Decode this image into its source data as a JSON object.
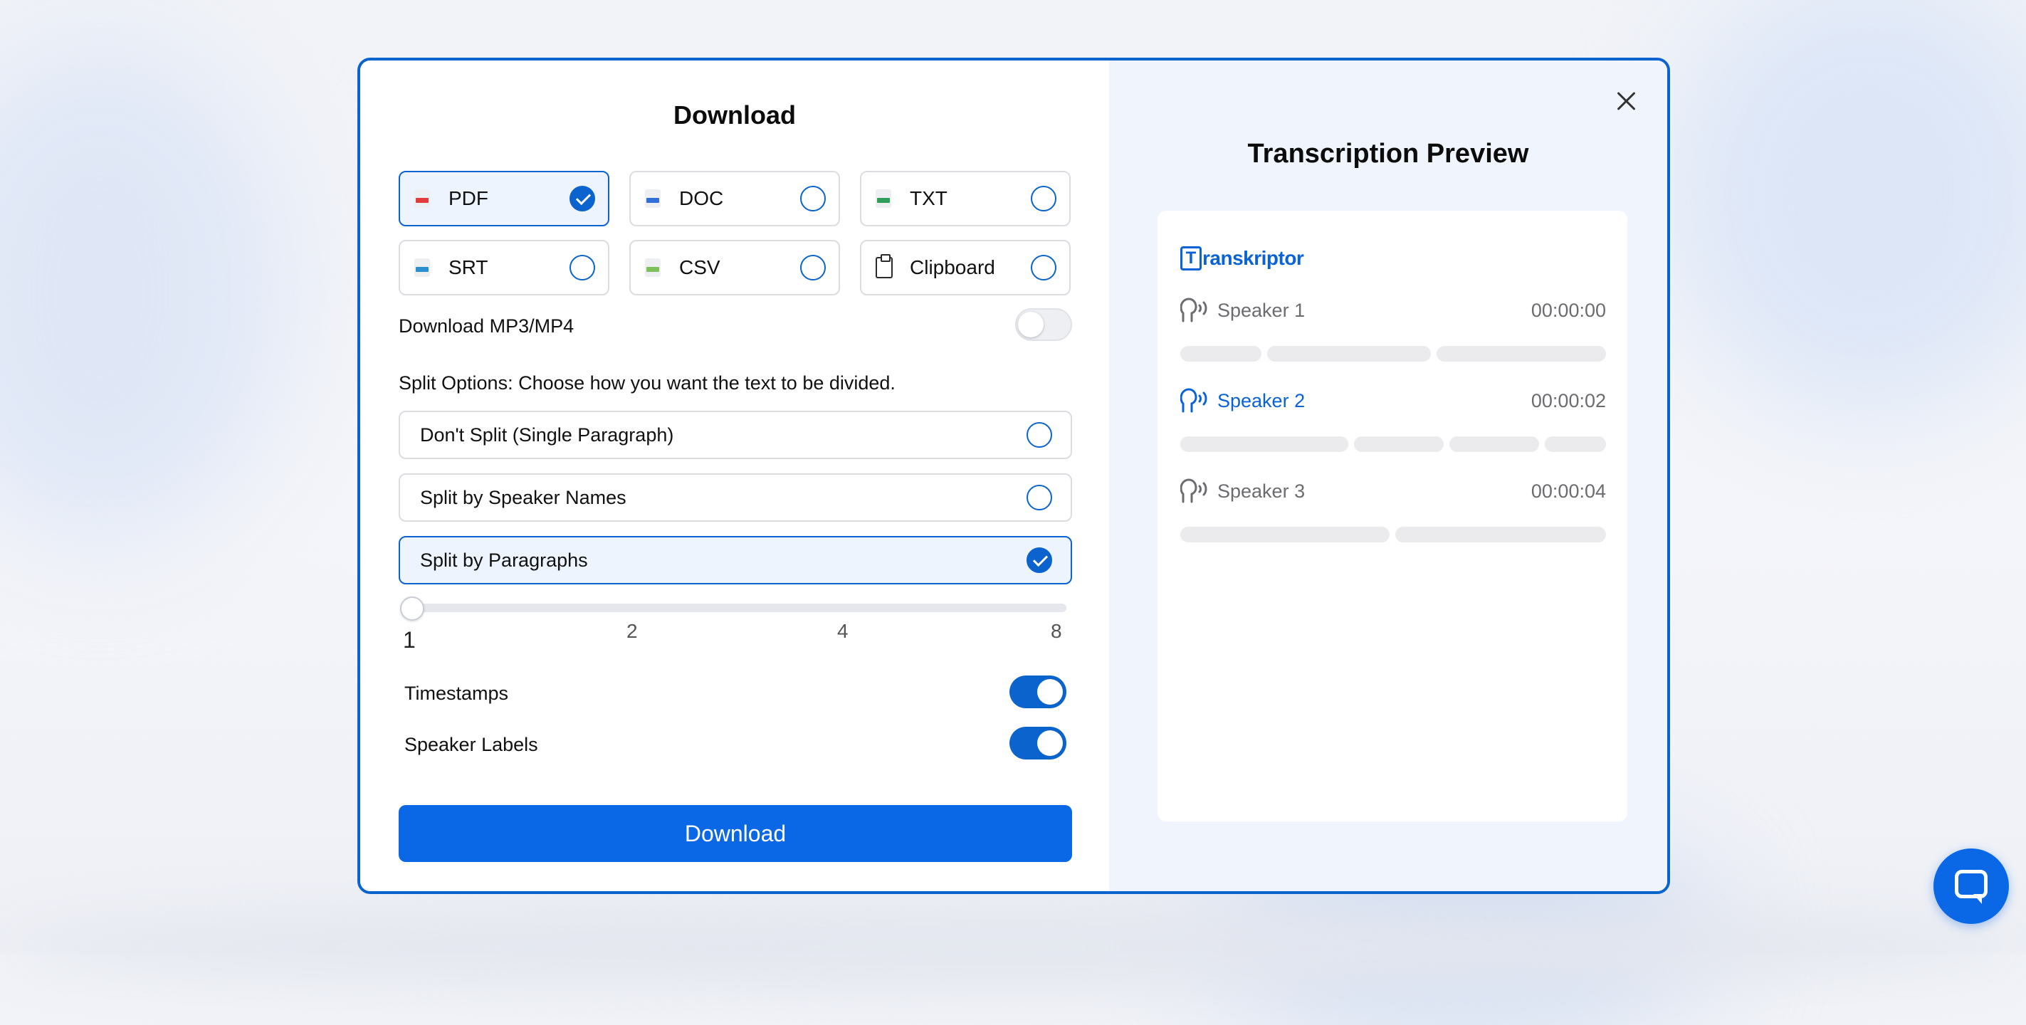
{
  "modal": {
    "title": "Download",
    "formats": [
      {
        "label": "PDF",
        "icon": "pdf-file-icon",
        "color": "#e23b3b",
        "selected": true
      },
      {
        "label": "DOC",
        "icon": "doc-file-icon",
        "color": "#2f6fd6",
        "selected": false
      },
      {
        "label": "TXT",
        "icon": "txt-file-icon",
        "color": "#2f9e5b",
        "selected": false
      },
      {
        "label": "SRT",
        "icon": "srt-file-icon",
        "color": "#2a8fd0",
        "selected": false
      },
      {
        "label": "CSV",
        "icon": "csv-file-icon",
        "color": "#7cc05a",
        "selected": false
      },
      {
        "label": "Clipboard",
        "icon": "clipboard-icon",
        "selected": false
      }
    ],
    "mp3_label": "Download MP3/MP4",
    "mp3_enabled": false,
    "split_heading": "Split Options: Choose how you want the text to be divided.",
    "split_options": [
      {
        "label": "Don't Split (Single Paragraph)",
        "selected": false
      },
      {
        "label": "Split by Speaker Names",
        "selected": false
      },
      {
        "label": "Split by Paragraphs",
        "selected": true
      }
    ],
    "slider": {
      "value": 1,
      "ticks": [
        "1",
        "2",
        "4",
        "8"
      ]
    },
    "timestamps_label": "Timestamps",
    "timestamps_enabled": true,
    "speaker_labels_label": "Speaker Labels",
    "speaker_labels_enabled": true,
    "download_button": "Download"
  },
  "preview": {
    "title": "Transcription Preview",
    "brand_mark": "T",
    "brand_text": "ranskriptor",
    "speakers": [
      {
        "name": "Speaker 1",
        "time": "00:00:00",
        "active": false
      },
      {
        "name": "Speaker 2",
        "time": "00:00:02",
        "active": true
      },
      {
        "name": "Speaker 3",
        "time": "00:00:04",
        "active": false
      }
    ]
  },
  "colors": {
    "accent": "#0b63ce",
    "button": "#0a68e6",
    "preview_bg": "#eff4fd"
  }
}
